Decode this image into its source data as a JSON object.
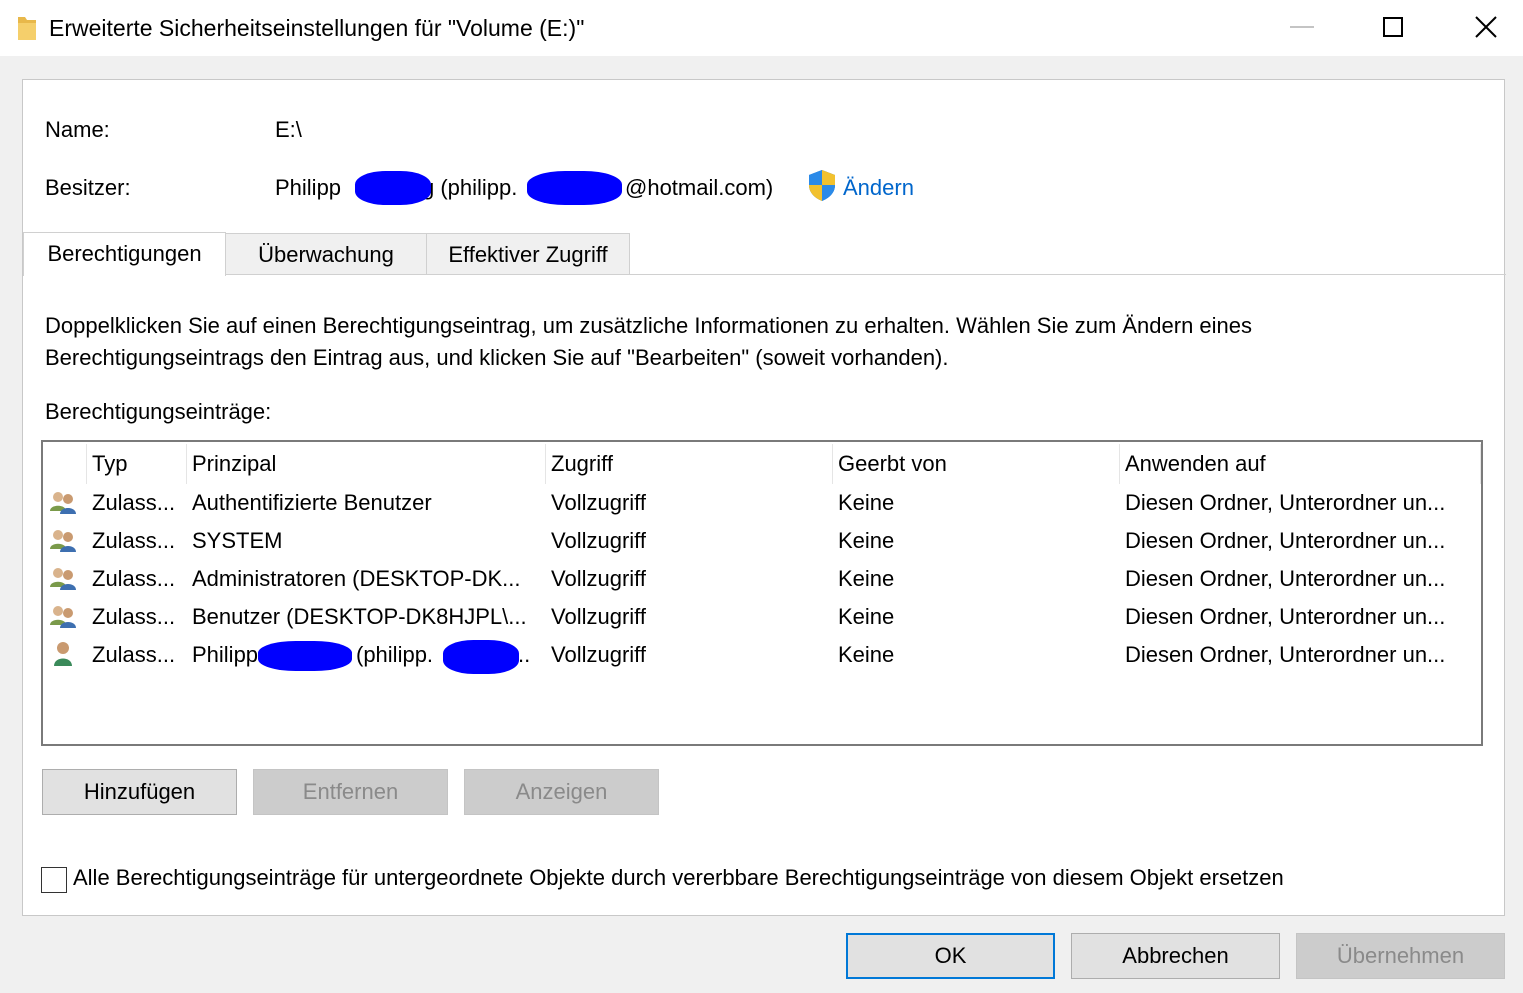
{
  "window": {
    "title": "Erweiterte Sicherheitseinstellungen für \"Volume (E:)\"",
    "minimize_icon": "minimize-icon",
    "maximize_icon": "maximize-icon",
    "close_icon": "close-icon"
  },
  "info": {
    "name_label": "Name:",
    "name_value": "E:\\",
    "owner_label": "Besitzer:",
    "owner_part1": "Philipp",
    "owner_part2": "g (philipp.",
    "owner_part3": "@hotmail.com)",
    "change_link": "Ändern",
    "change_icon": "uac-shield-icon"
  },
  "tabs": [
    {
      "label": "Berechtigungen",
      "active": true
    },
    {
      "label": "Überwachung",
      "active": false
    },
    {
      "label": "Effektiver Zugriff",
      "active": false
    }
  ],
  "description_line1": "Doppelklicken Sie auf einen Berechtigungseintrag, um zusätzliche Informationen zu erhalten. Wählen Sie zum Ändern eines",
  "description_line2": "Berechtigungseintrags den Eintrag aus, und klicken Sie auf \"Bearbeiten\" (soweit vorhanden).",
  "entries_label": "Berechtigungseinträge:",
  "table": {
    "columns": [
      "Typ",
      "Prinzipal",
      "Zugriff",
      "Geerbt von",
      "Anwenden auf"
    ],
    "rows": [
      {
        "icon": "group-icon",
        "type": "Zulass...",
        "principal": "Authentifizierte Benutzer",
        "access": "Vollzugriff",
        "inherited": "Keine",
        "applies": "Diesen Ordner, Unterordner un..."
      },
      {
        "icon": "group-icon",
        "type": "Zulass...",
        "principal": "SYSTEM",
        "access": "Vollzugriff",
        "inherited": "Keine",
        "applies": "Diesen Ordner, Unterordner un..."
      },
      {
        "icon": "group-icon",
        "type": "Zulass...",
        "principal": "Administratoren (DESKTOP-DK...",
        "access": "Vollzugriff",
        "inherited": "Keine",
        "applies": "Diesen Ordner, Unterordner un..."
      },
      {
        "icon": "group-icon",
        "type": "Zulass...",
        "principal": "Benutzer (DESKTOP-DK8HJPL\\...",
        "access": "Vollzugriff",
        "inherited": "Keine",
        "applies": "Diesen Ordner, Unterordner un..."
      },
      {
        "icon": "user-icon",
        "type": "Zulass...",
        "principal_part1": "Philipp",
        "principal_part2": "(philipp.",
        "principal_part3": "..",
        "access": "Vollzugriff",
        "inherited": "Keine",
        "applies": "Diesen Ordner, Unterordner un..."
      }
    ]
  },
  "buttons": {
    "add": "Hinzufügen",
    "remove": "Entfernen",
    "view": "Anzeigen",
    "ok": "OK",
    "cancel": "Abbrechen",
    "apply": "Übernehmen"
  },
  "replace_checkbox": {
    "label": "Alle Berechtigungseinträge für untergeordnete Objekte durch vererbbare Berechtigungseinträge von diesem Objekt ersetzen",
    "checked": false
  },
  "colors": {
    "link": "#0066cc",
    "redaction": "#0000ff",
    "focus_border": "#0078d7"
  }
}
